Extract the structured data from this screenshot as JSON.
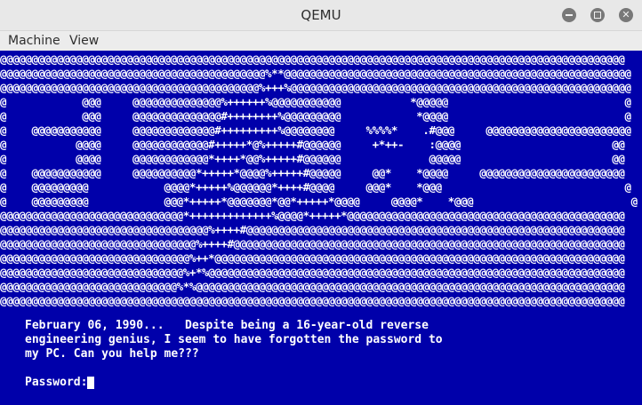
{
  "window": {
    "title": "QEMU",
    "controls": {
      "minimize_icon": "minimize-icon",
      "maximize_icon": "maximize-icon",
      "close_icon": "close-icon",
      "close_glyph": "✕"
    }
  },
  "menubar": {
    "items": [
      {
        "label": "Machine"
      },
      {
        "label": "View"
      }
    ]
  },
  "screen": {
    "background": "#0000aa",
    "foreground": "#ffffff",
    "ascii_art": "@@@@@@@@@@@@@@@@@@@@@@@@@@@@@@@@@@@@@@@@@@@@@@@@@@@@@@@@@@@@@@@@@@@@@@@@@@@@@@@@@@@@@@@@@@@@@@@@@@@\n@@@@@@@@@@@@@@@@@@@@@@@@@@@@@@@@@@@@@@@@@@%**@@@@@@@@@@@@@@@@@@@@@@@@@@@@@@@@@@@@@@@@@@@@@@@@@@@@@@@\n@@@@@@@@@@@@@@@@@@@@@@@@@@@@@@@@@@@@@@@@@%+++%@@@@@@@@@@@@@@@@@@@@@@@@@@@@@@@@@@@@@@@@@@@@@@@@@@@@@@\n@            @@@     @@@@@@@@@@@@@@%++++++%@@@@@@@@@@@           *@@@@@                            @\n@            @@@     @@@@@@@@@@@@@@#++++++++%@@@@@@@@@            *@@@@                            @\n@    @@@@@@@@@@@     @@@@@@@@@@@@@#+++++++++%@@@@@@@@     %%%%*    .#@@@     @@@@@@@@@@@@@@@@@@@@@@@\n@           @@@@     @@@@@@@@@@@@#+++++*@%+++++#@@@@@@     +*++-    :@@@@                        @@\n@           @@@@     @@@@@@@@@@@@*++++*@@%+++++#@@@@@@              @@@@@                        @@\n@    @@@@@@@@@@@     @@@@@@@@@@*+++++*@@@@%+++++#@@@@@     @@*    *@@@@     @@@@@@@@@@@@@@@@@@@@@@@\n@    @@@@@@@@@            @@@@*+++++%@@@@@@*++++#@@@@     @@@*    *@@@                             @\n@    @@@@@@@@@            @@@*+++++*@@@@@@@*@@*+++++*@@@@     @@@@*    *@@@                         @\n@@@@@@@@@@@@@@@@@@@@@@@@@@@@@*+++++++++++++%@@@@*+++++*@@@@@@@@@@@@@@@@@@@@@@@@@@@@@@@@@@@@@@@@@@@@\n@@@@@@@@@@@@@@@@@@@@@@@@@@@@@@@@@%++++#@@@@@@@@@@@@@@@@@@@@@@@@@@@@@@@@@@@@@@@@@@@@@@@@@@@@@@@@@@@@\n@@@@@@@@@@@@@@@@@@@@@@@@@@@@@@@%++++#@@@@@@@@@@@@@@@@@@@@@@@@@@@@@@@@@@@@@@@@@@@@@@@@@@@@@@@@@@@@@@\n@@@@@@@@@@@@@@@@@@@@@@@@@@@@@@%++*@@@@@@@@@@@@@@@@@@@@@@@@@@@@@@@@@@@@@@@@@@@@@@@@@@@@@@@@@@@@@@@@@\n@@@@@@@@@@@@@@@@@@@@@@@@@@@@@%+*%@@@@@@@@@@@@@@@@@@@@@@@@@@@@@@@@@@@@@@@@@@@@@@@@@@@@@@@@@@@@@@@@@@\n@@@@@@@@@@@@@@@@@@@@@@@@@@@@%*%@@@@@@@@@@@@@@@@@@@@@@@@@@@@@@@@@@@@@@@@@@@@@@@@@@@@@@@@@@@@@@@@@@@@\n@@@@@@@@@@@@@@@@@@@@@@@@@@@@@@@@@@@@@@@@@@@@@@@@@@@@@@@@@@@@@@@@@@@@@@@@@@@@@@@@@@@@@@@@@@@@@@@@@@@",
    "message": "February 06, 1990...   Despite being a 16-year-old reverse\nengineering genius, I seem to have forgotten the password to\nmy PC. Can you help me???",
    "password_label": "Password:",
    "password_value": ""
  }
}
